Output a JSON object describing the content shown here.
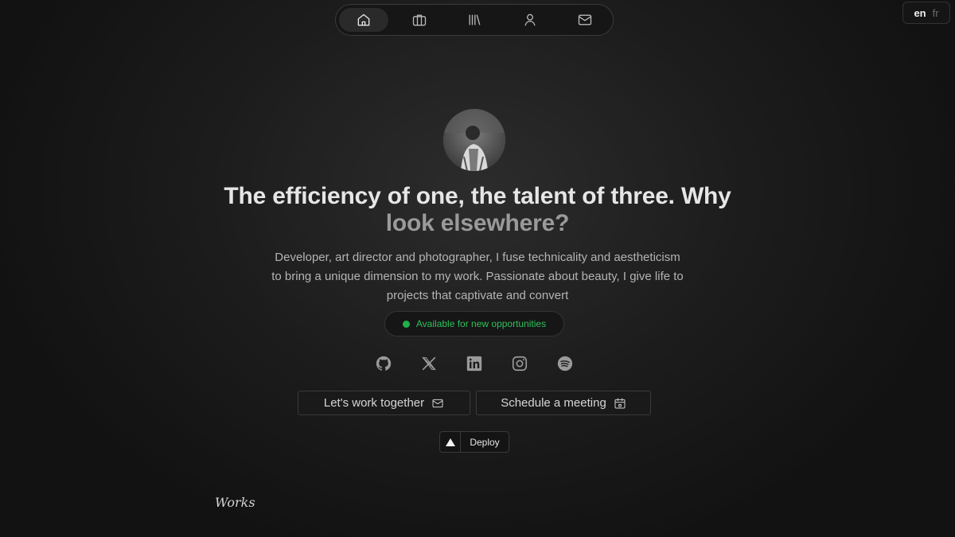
{
  "nav": {
    "items": [
      {
        "icon": "home-icon",
        "active": true
      },
      {
        "icon": "briefcase-icon",
        "active": false
      },
      {
        "icon": "library-icon",
        "active": false
      },
      {
        "icon": "user-icon",
        "active": false
      },
      {
        "icon": "mail-icon",
        "active": false
      }
    ]
  },
  "language": {
    "current": "en",
    "alternate": "fr"
  },
  "hero": {
    "headline_primary": "The efficiency of one, the talent of three. Why",
    "headline_secondary": "look elsewhere?",
    "description": "Developer, art director and photographer, I fuse technicality and aestheticism to bring a unique dimension to my work. Passionate about beauty, I give life to projects that captivate and convert",
    "availability": "Available for new opportunities",
    "availability_color": "#1fb04a"
  },
  "socials": [
    "github-icon",
    "x-icon",
    "linkedin-icon",
    "instagram-icon",
    "spotify-icon"
  ],
  "actions": {
    "work_together": "Let's work together",
    "schedule_meeting": "Schedule a meeting"
  },
  "deploy": {
    "label": "Deploy"
  },
  "sections": {
    "works": "Works"
  }
}
